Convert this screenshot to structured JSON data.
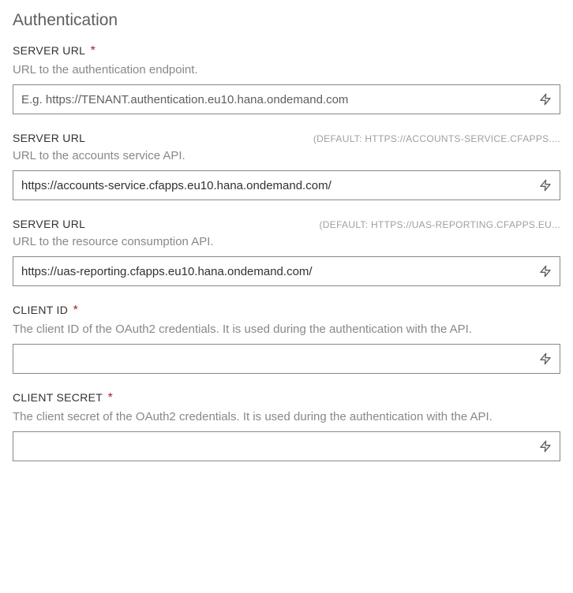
{
  "section": {
    "heading": "Authentication"
  },
  "fields": {
    "auth_server": {
      "label": "SERVER URL",
      "required_mark": "*",
      "description": "URL to the authentication endpoint.",
      "placeholder": "E.g. https://TENANT.authentication.eu10.hana.ondemand.com",
      "value": ""
    },
    "accounts_server": {
      "label": "SERVER URL",
      "default_hint": "(DEFAULT: HTTPS://ACCOUNTS-SERVICE.CFAPPS....",
      "description": "URL to the accounts service API.",
      "value": "https://accounts-service.cfapps.eu10.hana.ondemand.com/"
    },
    "uas_server": {
      "label": "SERVER URL",
      "default_hint": "(DEFAULT: HTTPS://UAS-REPORTING.CFAPPS.EU...",
      "description": "URL to the resource consumption API.",
      "value": "https://uas-reporting.cfapps.eu10.hana.ondemand.com/"
    },
    "client_id": {
      "label": "CLIENT ID",
      "required_mark": "*",
      "description": "The client ID of the OAuth2 credentials. It is used during the authentication with the API.",
      "value": ""
    },
    "client_secret": {
      "label": "CLIENT SECRET",
      "required_mark": "*",
      "description": "The client secret of the OAuth2 credentials. It is used during the authentication with the API.",
      "value": ""
    }
  }
}
